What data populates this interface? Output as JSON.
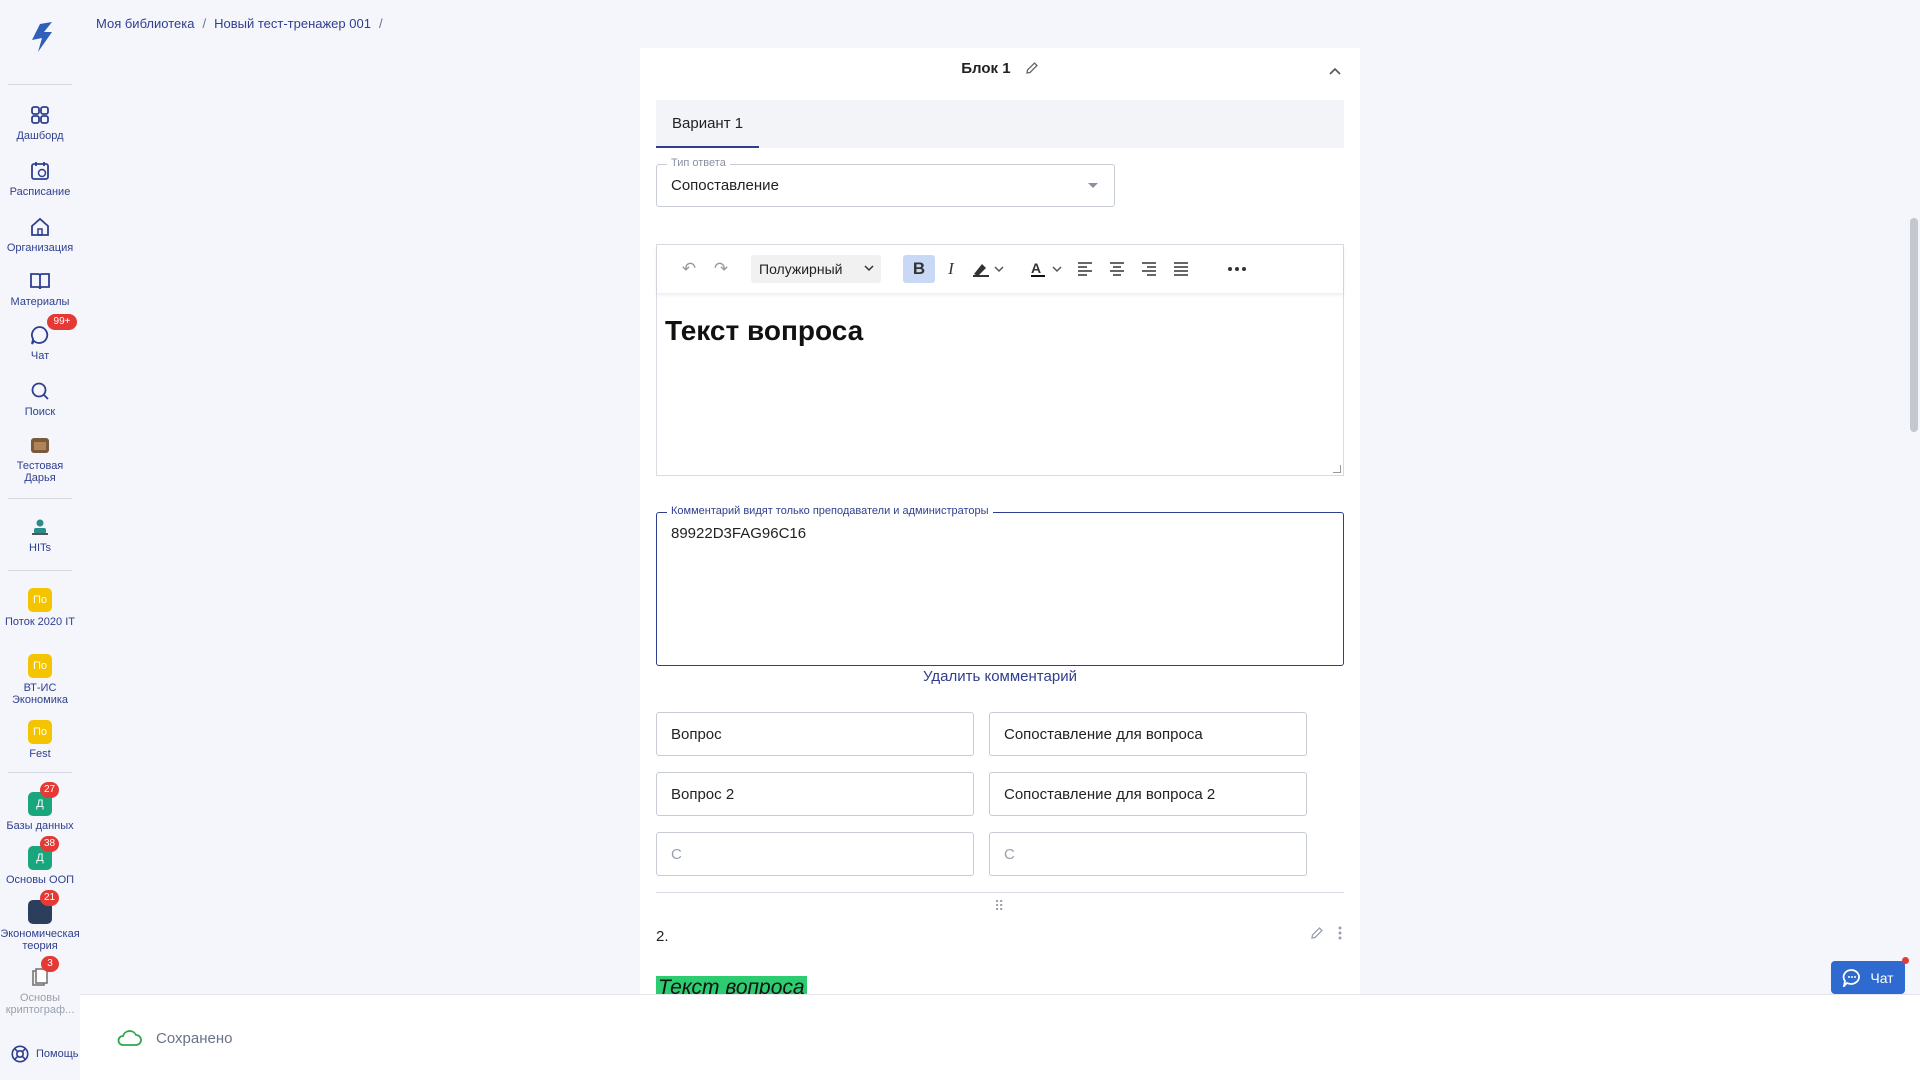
{
  "breadcrumbs": [
    "Моя библиотека",
    "Новый тест-тренажер 001"
  ],
  "breadcrumb_sep": "/",
  "sidebar": {
    "items": [
      {
        "label": "Дашборд"
      },
      {
        "label": "Расписание"
      },
      {
        "label": "Организация"
      },
      {
        "label": "Материалы"
      },
      {
        "label": "Чат",
        "badge": "99+"
      },
      {
        "label": "Поиск"
      },
      {
        "label": "Тестовая Дарья"
      },
      {
        "label": "HITs"
      },
      {
        "label": "Поток 2020 IT",
        "letters": "По"
      },
      {
        "label": "ВТ-ИС Экономика",
        "letters": "По"
      },
      {
        "label": "Fest",
        "letters": "По"
      },
      {
        "label": "Базы данных",
        "letters": "Д",
        "badge": "27"
      },
      {
        "label": "Основы ООП",
        "letters": "Д",
        "badge": "38"
      },
      {
        "label": "Экономическая теория",
        "badge": "21"
      },
      {
        "label": "Основы криптограф...",
        "badge": "3"
      }
    ],
    "help": "Помощь"
  },
  "block": {
    "title": "Блок 1",
    "tab": "Вариант 1",
    "answer_type_label": "Тип ответа",
    "answer_type_value": "Сопоставление",
    "format_select": "Полужирный",
    "question_text": "Текст вопроса",
    "comment_label": "Комментарий видят только преподаватели и администраторы",
    "comment_value": "89922D3FAG96C16",
    "delete_comment": "Удалить комментарий",
    "pairs": [
      {
        "left": "Вопрос",
        "right": "Сопоставление для вопроса"
      },
      {
        "left": "Вопрос 2",
        "right": "Сопоставление для вопроса 2"
      },
      {
        "left_placeholder": "С",
        "right_placeholder": "С"
      }
    ],
    "next_question_number": "2.",
    "next_question_text": "Текст вопроса"
  },
  "footer": {
    "status": "Сохранено"
  },
  "chat_button": "Чат",
  "colors": {
    "accent": "#2f3f8f",
    "highlight": "#2ecc71",
    "badge": "#e53935",
    "yellow": "#f5c400",
    "green": "#1aa67c"
  }
}
